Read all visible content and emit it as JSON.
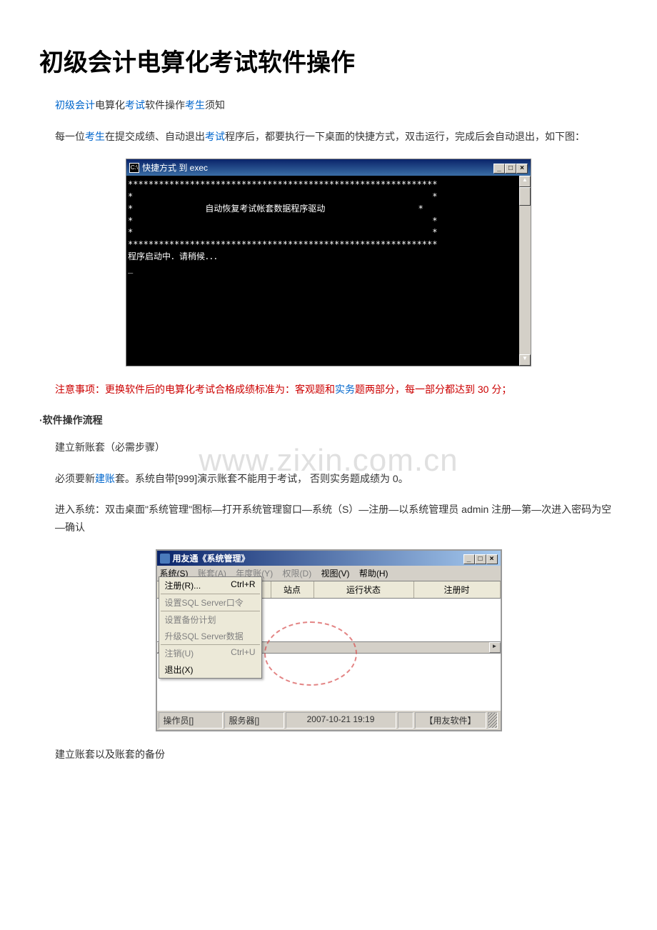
{
  "page_title": "初级会计电算化考试软件操作",
  "sub_title_parts": {
    "p1": "初级会计",
    "p2": "电算化",
    "p3": "考试",
    "p4": "软件操作",
    "p5": "考生",
    "p6": "须知"
  },
  "intro": {
    "t1": "每一位",
    "link1": "考生",
    "t2": "在提交成绩、自动退出",
    "link2": "考试",
    "t3": "程序后，都要执行一下桌面的快捷方式，双击运行，完成后会自动退出，如下图："
  },
  "cmd_window": {
    "title": "快捷方式 到 exec",
    "cmd_prefix": "C:\\",
    "line_border": "************************************************************",
    "line_star": "*",
    "line_text": "              自动恢复考试帐套数据程序驱动",
    "line_starting": "程序启动中．请稍候．．．",
    "cursor": "_"
  },
  "notice": {
    "red_part": "注意事项：更换软件后的电算化考试合格成绩标准为：客观题和",
    "link": "实务",
    "red_end": "题两部分，每一部分都达到 30 分；"
  },
  "section_title": "·软件操作流程",
  "para1": "建立新账套（必需步骤）",
  "para2": {
    "t1": "必须要新",
    "link": "建账",
    "t2": "套。系统自带[999]演示账套不能用于考试，  否则实务题成绩为 0。"
  },
  "para3": "进入系统：双击桌面\"系统管理\"图标—打开系统管理窗口—系统（S）—注册—以系统管理员 admin 注册—第—次进入密码为空—确认",
  "app_window": {
    "title": "用友通《系统管理》",
    "menu": {
      "system": "系统(S)",
      "account": "账套(A)",
      "year": "年度账(Y)",
      "auth": "权限(D)",
      "view": "视图(V)",
      "help": "帮助(H)"
    },
    "dropdown": {
      "register": "注册(R)...",
      "register_key": "Ctrl+R",
      "sql_cmd": "设置SQL Server口令",
      "backup_plan": "设置备份计划",
      "upgrade_sql": "升级SQL Server数据",
      "logout": "注销(U)",
      "logout_key": "Ctrl+U",
      "exit": "退出(X)"
    },
    "columns": {
      "col1_blank": "",
      "col2": "站点",
      "col3": "运行状态",
      "col4": "注册时"
    },
    "statusbar": {
      "operator": "操作员[]",
      "server": "服务器[]",
      "time": "2007-10-21 19:19",
      "software": "【用友软件】"
    }
  },
  "last_para": "建立账套以及账套的备份",
  "watermark": "www.zixin.com.cn"
}
